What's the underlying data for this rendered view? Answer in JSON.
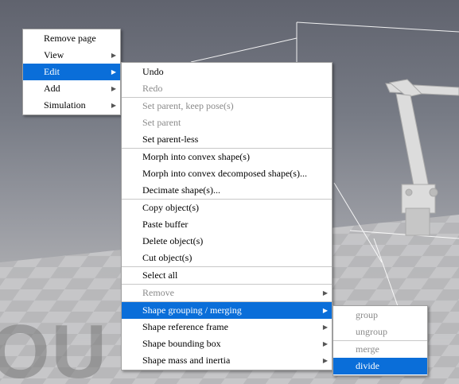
{
  "main_menu": {
    "items": [
      {
        "label": "Remove page",
        "submenu": false,
        "state": "normal"
      },
      {
        "label": "View",
        "submenu": true,
        "state": "normal"
      },
      {
        "label": "Edit",
        "submenu": true,
        "state": "active"
      },
      {
        "label": "Add",
        "submenu": true,
        "state": "normal"
      },
      {
        "label": "Simulation",
        "submenu": true,
        "state": "normal"
      }
    ]
  },
  "edit_menu": {
    "items": [
      {
        "label": "Undo",
        "state": "normal"
      },
      {
        "label": "Redo",
        "state": "disabled"
      },
      {
        "label": "Set parent, keep pose(s)",
        "state": "disabled"
      },
      {
        "label": "Set parent",
        "state": "disabled"
      },
      {
        "label": "Set parent-less",
        "state": "normal"
      },
      {
        "label": "Morph into convex shape(s)",
        "state": "normal"
      },
      {
        "label": "Morph into convex decomposed shape(s)...",
        "state": "normal"
      },
      {
        "label": "Decimate shape(s)...",
        "state": "normal"
      },
      {
        "label": "Copy object(s)",
        "state": "normal"
      },
      {
        "label": "Paste buffer",
        "state": "normal"
      },
      {
        "label": "Delete object(s)",
        "state": "normal"
      },
      {
        "label": "Cut object(s)",
        "state": "normal"
      },
      {
        "label": "Select all",
        "state": "normal"
      },
      {
        "label": "Remove",
        "state": "disabled"
      },
      {
        "label": "Shape grouping / merging",
        "state": "active"
      },
      {
        "label": "Shape reference frame",
        "state": "normal"
      },
      {
        "label": "Shape bounding box",
        "state": "normal"
      },
      {
        "label": "Shape mass and inertia",
        "state": "normal"
      }
    ]
  },
  "group_menu": {
    "items": [
      {
        "label": "group",
        "state": "disabled"
      },
      {
        "label": "ungroup",
        "state": "disabled"
      },
      {
        "label": "merge",
        "state": "disabled"
      },
      {
        "label": "divide",
        "state": "active"
      }
    ]
  },
  "scene": {
    "watermark": "OU",
    "submenu_arrow": "▶"
  },
  "colors": {
    "highlight": "#0a6ed9",
    "disabled_text": "#8a8a8a"
  }
}
